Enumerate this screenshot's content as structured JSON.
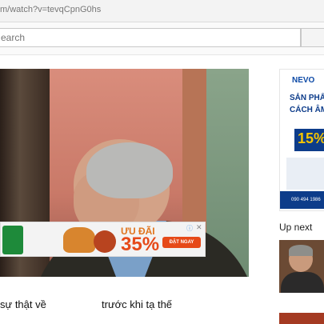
{
  "browser": {
    "url_prefix": "m/watch?v=",
    "url_id": "tevqCpnG0hs"
  },
  "search": {
    "placeholder": "earch"
  },
  "ad_banner": {
    "promo_label": "ƯU ĐÃI",
    "discount": "35%",
    "cta": "ĐẶT NGAY",
    "info_icon": "info-icon",
    "close_icon": "close-icon"
  },
  "sidebar_ad": {
    "brand": "NEVO",
    "line1": "SẢN PHẨ",
    "line2": "CÁCH ÂM",
    "promo": "15%",
    "phone": "090 494 1986"
  },
  "up_next": {
    "label": "Up next"
  },
  "video": {
    "title_left": "sự thật về",
    "title_right": "trước khi tạ thế"
  }
}
